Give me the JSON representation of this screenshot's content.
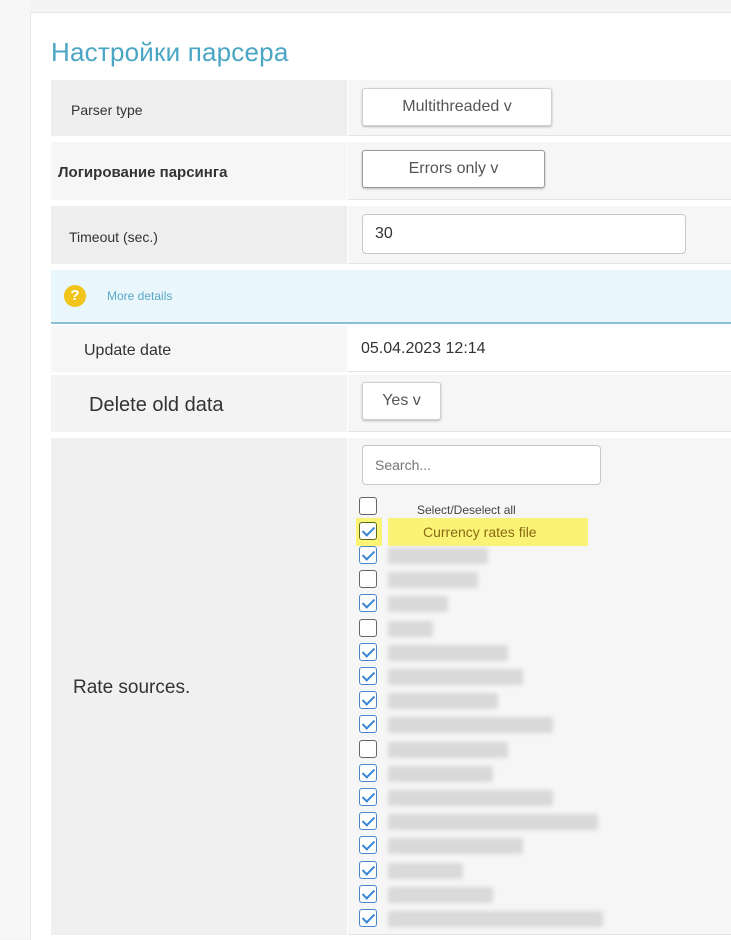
{
  "title": "Настройки парсера",
  "rows": {
    "parser_type": {
      "label": "Parser type",
      "value": "Multithreaded v"
    },
    "logging": {
      "label": "Логирование парсинга",
      "value": "Errors only v"
    },
    "timeout": {
      "label": "Timeout (sec.)",
      "value": "30"
    },
    "info": {
      "link": "More details",
      "icon": "question-icon",
      "icon_glyph": "?"
    },
    "update_date": {
      "label": "Update date",
      "value": "05.04.2023 12:14"
    },
    "delete_old": {
      "label": "Delete old data",
      "value": "Yes v"
    },
    "rate_sources": {
      "label": "Rate sources.",
      "search_placeholder": "Search...",
      "select_all_label": "Select/Deselect all",
      "highlighted_item": "Currency rates file",
      "items_checked": [
        true,
        false,
        true,
        false,
        true,
        true,
        true,
        true,
        false,
        true,
        true,
        true,
        true,
        true,
        true,
        true
      ]
    }
  },
  "colors": {
    "title": "#4aa6c4",
    "info_bg": "#e9f6fb",
    "info_border": "#86bfd6",
    "icon_yellow": "#f0c419",
    "highlight": "#fbf24a",
    "check": "#3a86d4"
  }
}
